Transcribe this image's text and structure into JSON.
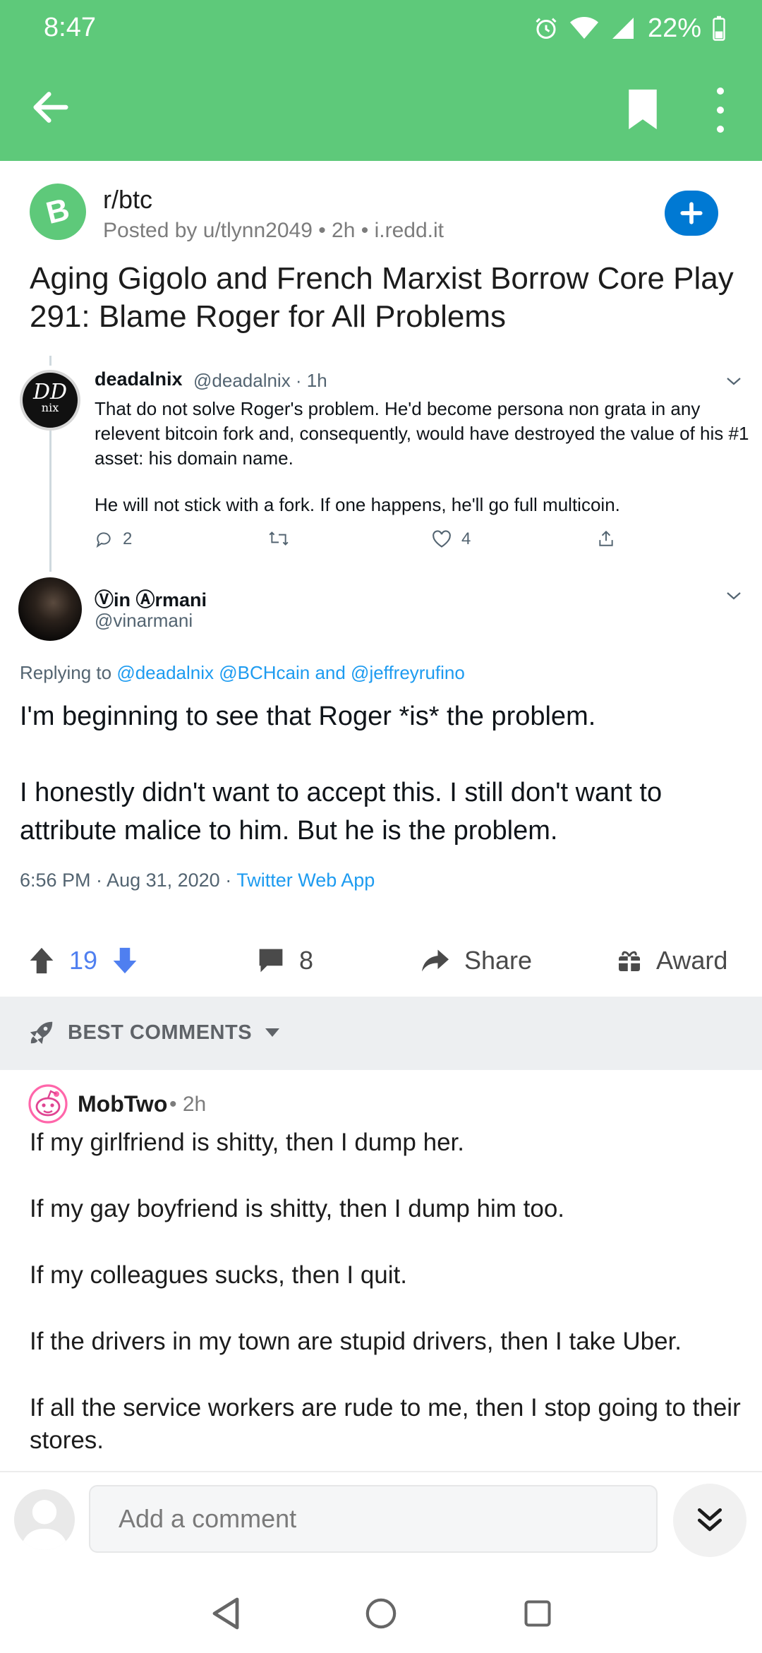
{
  "status": {
    "time": "8:47",
    "battery": "22%"
  },
  "appbar": {
    "back_icon": "back-arrow-icon",
    "bookmark_icon": "bookmark-icon",
    "more_icon": "more-vertical-icon"
  },
  "post": {
    "subreddit": "r/btc",
    "meta": "Posted by u/tlynn2049 • 2h • i.redd.it",
    "title": "Aging Gigolo and French Marxist Borrow Core Play 291: Blame Roger for All Problems"
  },
  "tweet1": {
    "name": "deadalⓃⒾⓧ",
    "name_display": "deadalnix",
    "handle": "@deadalnix · 1h",
    "text1": "That do not solve Roger's problem. He'd become persona non grata in any relevent bitcoin fork and, consequently, would have destroyed the value of his #1 asset: his domain name.",
    "text2": "He will not stick with a fork. If one happens, he'll go full multicoin.",
    "replies": "2",
    "likes": "4"
  },
  "tweet2": {
    "name": "Ⓥin Ⓐrmani",
    "handle": "@vinarmani",
    "replying_prefix": "Replying to ",
    "replying_links": "@deadalnix @BCHcain and @jeffreyrufino",
    "text1": "I'm beginning to see that Roger *is* the problem.",
    "text2": "I honestly didn't want to accept this. I still don't want to attribute malice to him. But he is the problem.",
    "date": "6:56 PM · Aug 31, 2020 · ",
    "source": "Twitter Web App"
  },
  "actions": {
    "votes": "19",
    "comments": "8",
    "share": "Share",
    "award": "Award"
  },
  "sort": {
    "label": "BEST COMMENTS"
  },
  "comment": {
    "author": "MobTwo",
    "time": "• 2h",
    "lines": [
      "If my girlfriend is shitty, then I dump her.",
      "If my gay boyfriend is shitty, then I dump him too.",
      "If my colleagues sucks, then I quit.",
      "If the drivers in my town are stupid drivers, then I take Uber.",
      "If all the service workers are rude to me, then I stop going to their stores."
    ]
  },
  "composer": {
    "placeholder": "Add a comment"
  },
  "colors": {
    "header": "#5ec97a",
    "accent_blue": "#0079d3",
    "vote_blue": "#4f7ff0",
    "twitter_blue": "#1d9bf0"
  }
}
